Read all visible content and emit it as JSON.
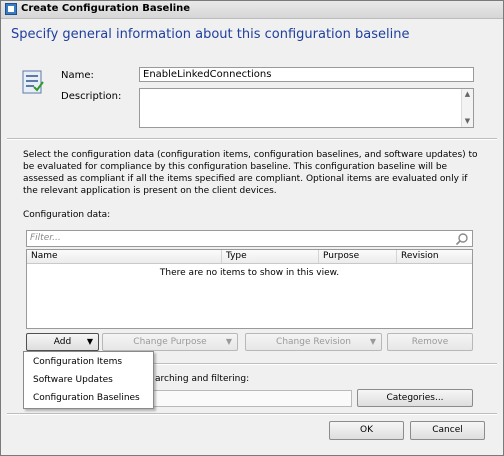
{
  "window": {
    "title": "Create Configuration Baseline"
  },
  "heading": "Specify general information about this configuration baseline",
  "form": {
    "name_label": "Name:",
    "name_value": "EnableLinkedConnections",
    "description_label": "Description:",
    "description_value": ""
  },
  "instructions": "Select the configuration data (configuration items, configuration baselines, and software updates) to be evaluated for compliance by this configuration baseline. This configuration baseline will be assessed as compliant if all the items specified are compliant. Optional items are evaluated only if the relevant application is present on  the client devices.",
  "config_data": {
    "label": "Configuration data:",
    "filter_placeholder": "Filter...",
    "columns": [
      "Name",
      "Type",
      "Purpose",
      "Revision"
    ],
    "empty_message": "There are no items to show in this view."
  },
  "buttons": {
    "add": "Add",
    "change_purpose": "Change Purpose",
    "change_revision": "Change Revision",
    "remove": "Remove",
    "categories": "Categories...",
    "ok": "OK",
    "cancel": "Cancel"
  },
  "add_menu": [
    "Configuration Items",
    "Software Updates",
    "Configuration Baselines"
  ],
  "partial_label": "arching and filtering:",
  "icons": {
    "title": "window-icon",
    "baseline": "configuration-baseline-icon",
    "search": "search-icon",
    "dropdown": "dropdown-arrow-icon"
  },
  "colors": {
    "heading": "#1f3f9f",
    "background": "#f0f0f0"
  }
}
